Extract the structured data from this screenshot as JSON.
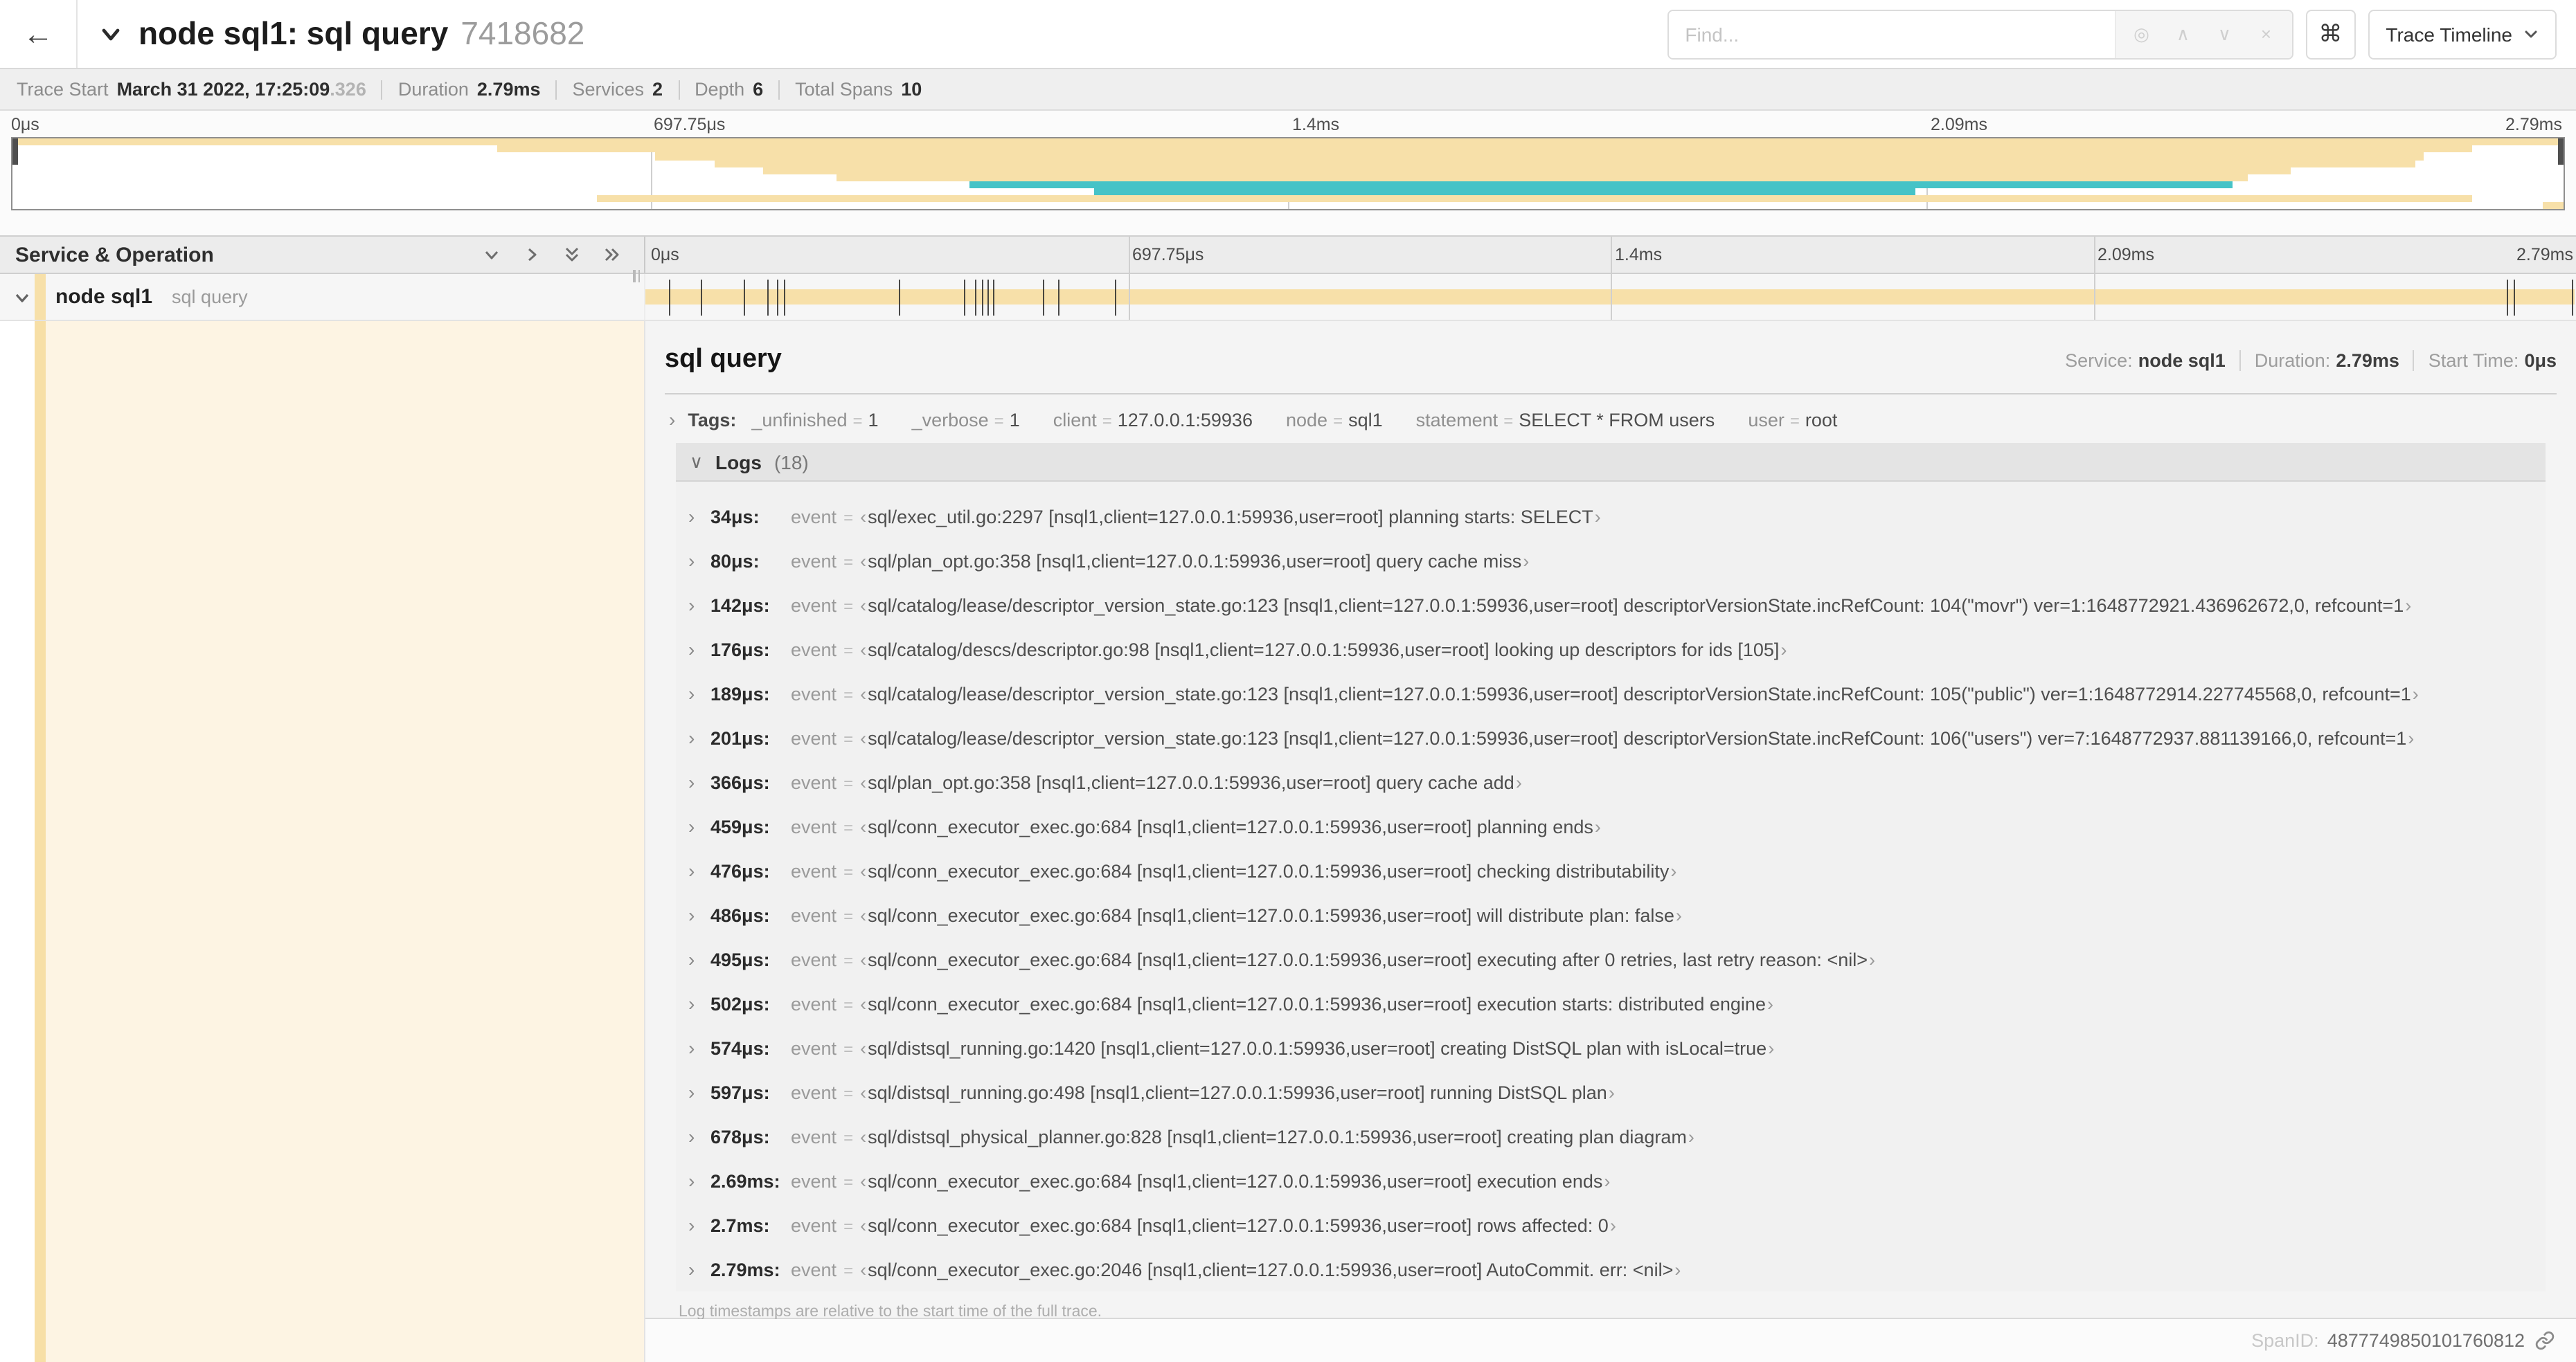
{
  "header": {
    "back_icon": "←",
    "title": "node sql1: sql query",
    "trace_id": "7418682",
    "find_placeholder": "Find...",
    "find_icons": [
      {
        "name": "locate-icon",
        "glyph": "◎"
      },
      {
        "name": "chevron-up-icon",
        "glyph": "∧"
      },
      {
        "name": "chevron-down-icon",
        "glyph": "∨"
      },
      {
        "name": "clear-icon",
        "glyph": "×"
      }
    ],
    "shortcut_glyph": "⌘",
    "view_select": "Trace Timeline"
  },
  "stats": [
    {
      "label": "Trace Start",
      "value": "March 31 2022, 17:25:09",
      "suffix": ".326"
    },
    {
      "label": "Duration",
      "value": "2.79ms"
    },
    {
      "label": "Services",
      "value": "2"
    },
    {
      "label": "Depth",
      "value": "6"
    },
    {
      "label": "Total Spans",
      "value": "10"
    }
  ],
  "timeline": {
    "ticks": [
      "0μs",
      "697.75μs",
      "1.4ms",
      "2.09ms",
      "2.79ms"
    ],
    "colors": {
      "tan": "#F7E0A9",
      "teal": "#46C3C7"
    },
    "minimap_spans": [
      {
        "row": 0,
        "start": 0,
        "end": 100,
        "color": "tan"
      },
      {
        "row": 1,
        "start": 19,
        "end": 96.4,
        "color": "tan"
      },
      {
        "row": 2,
        "start": 25.2,
        "end": 94.5,
        "color": "tan"
      },
      {
        "row": 3,
        "start": 27.5,
        "end": 94.2,
        "color": "tan"
      },
      {
        "row": 4,
        "start": 29.4,
        "end": 89.3,
        "color": "tan"
      },
      {
        "row": 5,
        "start": 32.3,
        "end": 87.6,
        "color": "tan"
      },
      {
        "row": 6,
        "start": 37.5,
        "end": 87.0,
        "color": "teal"
      },
      {
        "row": 7,
        "start": 42.4,
        "end": 74.6,
        "color": "teal"
      },
      {
        "row": 8,
        "start": 22.9,
        "end": 96.4,
        "color": "tan"
      },
      {
        "row": 9,
        "start": 99.2,
        "end": 100,
        "color": "tan"
      }
    ]
  },
  "span_table": {
    "header_label": "Service & Operation",
    "row": {
      "service": "node sql1",
      "operation": "sql query"
    }
  },
  "detail": {
    "title": "sql query",
    "meta": {
      "service_label": "Service:",
      "service": "node sql1",
      "duration_label": "Duration:",
      "duration": "2.79ms",
      "start_label": "Start Time:",
      "start": "0μs"
    },
    "tags_label": "Tags:",
    "tags": [
      {
        "key": "_unfinished",
        "value": "1"
      },
      {
        "key": "_verbose",
        "value": "1"
      },
      {
        "key": "client",
        "value": "127.0.0.1:59936"
      },
      {
        "key": "node",
        "value": "sql1"
      },
      {
        "key": "statement",
        "value": "SELECT * FROM users"
      },
      {
        "key": "user",
        "value": "root"
      }
    ],
    "logs_label": "Logs",
    "logs_count": "(18)",
    "log_field_key": "event",
    "logs": [
      {
        "time": "34μs:",
        "pct": 1.2,
        "value": "sql/exec_util.go:2297 [nsql1,client=127.0.0.1:59936,user=root] planning starts: SELECT"
      },
      {
        "time": "80μs:",
        "pct": 2.9,
        "value": "sql/plan_opt.go:358 [nsql1,client=127.0.0.1:59936,user=root] query cache miss"
      },
      {
        "time": "142μs:",
        "pct": 5.1,
        "value": "sql/catalog/lease/descriptor_version_state.go:123 [nsql1,client=127.0.0.1:59936,user=root] descriptorVersionState.incRefCount: 104(\"movr\") ver=1:1648772921.436962672,0, refcount=1"
      },
      {
        "time": "176μs:",
        "pct": 6.3,
        "value": "sql/catalog/descs/descriptor.go:98 [nsql1,client=127.0.0.1:59936,user=root] looking up descriptors for ids [105]"
      },
      {
        "time": "189μs:",
        "pct": 6.8,
        "value": "sql/catalog/lease/descriptor_version_state.go:123 [nsql1,client=127.0.0.1:59936,user=root] descriptorVersionState.incRefCount: 105(\"public\") ver=1:1648772914.227745568,0, refcount=1"
      },
      {
        "time": "201μs:",
        "pct": 7.2,
        "value": "sql/catalog/lease/descriptor_version_state.go:123 [nsql1,client=127.0.0.1:59936,user=root] descriptorVersionState.incRefCount: 106(\"users\") ver=7:1648772937.881139166,0, refcount=1"
      },
      {
        "time": "366μs:",
        "pct": 13.1,
        "value": "sql/plan_opt.go:358 [nsql1,client=127.0.0.1:59936,user=root] query cache add"
      },
      {
        "time": "459μs:",
        "pct": 16.5,
        "value": "sql/conn_executor_exec.go:684 [nsql1,client=127.0.0.1:59936,user=root] planning ends"
      },
      {
        "time": "476μs:",
        "pct": 17.1,
        "value": "sql/conn_executor_exec.go:684 [nsql1,client=127.0.0.1:59936,user=root] checking distributability"
      },
      {
        "time": "486μs:",
        "pct": 17.4,
        "value": "sql/conn_executor_exec.go:684 [nsql1,client=127.0.0.1:59936,user=root] will distribute plan: false"
      },
      {
        "time": "495μs:",
        "pct": 17.7,
        "value": "sql/conn_executor_exec.go:684 [nsql1,client=127.0.0.1:59936,user=root] executing after 0 retries, last retry reason: <nil>"
      },
      {
        "time": "502μs:",
        "pct": 18.0,
        "value": "sql/conn_executor_exec.go:684 [nsql1,client=127.0.0.1:59936,user=root] execution starts: distributed engine"
      },
      {
        "time": "574μs:",
        "pct": 20.6,
        "value": "sql/distsql_running.go:1420 [nsql1,client=127.0.0.1:59936,user=root] creating DistSQL plan with isLocal=true"
      },
      {
        "time": "597μs:",
        "pct": 21.4,
        "value": "sql/distsql_running.go:498 [nsql1,client=127.0.0.1:59936,user=root] running DistSQL plan"
      },
      {
        "time": "678μs:",
        "pct": 24.3,
        "value": "sql/distsql_physical_planner.go:828 [nsql1,client=127.0.0.1:59936,user=root] creating plan diagram"
      },
      {
        "time": "2.69ms:",
        "pct": 96.4,
        "value": "sql/conn_executor_exec.go:684 [nsql1,client=127.0.0.1:59936,user=root] execution ends"
      },
      {
        "time": "2.7ms:",
        "pct": 96.8,
        "value": "sql/conn_executor_exec.go:684 [nsql1,client=127.0.0.1:59936,user=root] rows affected: 0"
      },
      {
        "time": "2.79ms:",
        "pct": 99.8,
        "value": "sql/conn_executor_exec.go:2046 [nsql1,client=127.0.0.1:59936,user=root] AutoCommit. err: <nil>"
      }
    ],
    "footer": "Log timestamps are relative to the start time of the full trace.",
    "spanid_label": "SpanID:",
    "spanid": "4877749850101760812"
  }
}
